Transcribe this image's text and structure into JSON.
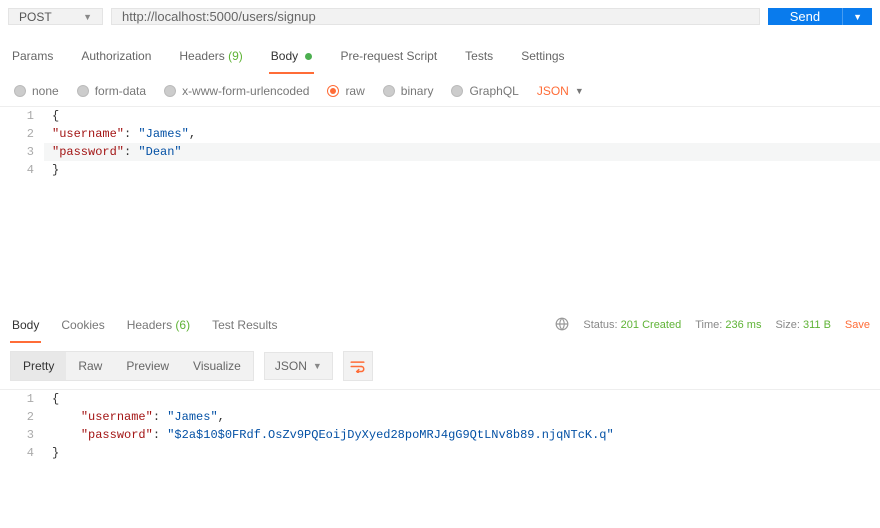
{
  "request": {
    "method": "POST",
    "url": "http://localhost:5000/users/signup",
    "send_label": "Send"
  },
  "tabs": {
    "params": "Params",
    "authorization": "Authorization",
    "headers": "Headers",
    "headers_count": "(9)",
    "body": "Body",
    "prerequest": "Pre-request Script",
    "tests": "Tests",
    "settings": "Settings"
  },
  "body_types": {
    "none": "none",
    "form_data": "form-data",
    "urlencoded": "x-www-form-urlencoded",
    "raw": "raw",
    "binary": "binary",
    "graphql": "GraphQL",
    "format": "JSON"
  },
  "request_body_lines": [
    {
      "n": "1",
      "indent": "",
      "tokens": [
        {
          "t": "p",
          "v": "{"
        }
      ]
    },
    {
      "n": "2",
      "indent": "",
      "tokens": [
        {
          "t": "k",
          "v": "\"username\""
        },
        {
          "t": "p",
          "v": ": "
        },
        {
          "t": "s",
          "v": "\"James\""
        },
        {
          "t": "p",
          "v": ","
        }
      ]
    },
    {
      "n": "3",
      "indent": "",
      "tokens": [
        {
          "t": "k",
          "v": "\"password\""
        },
        {
          "t": "p",
          "v": ": "
        },
        {
          "t": "s",
          "v": "\"Dean\""
        }
      ],
      "hl": true
    },
    {
      "n": "4",
      "indent": "",
      "tokens": [
        {
          "t": "p",
          "v": "}"
        }
      ]
    }
  ],
  "response_tabs": {
    "body": "Body",
    "cookies": "Cookies",
    "headers": "Headers",
    "headers_count": "(6)",
    "test_results": "Test Results"
  },
  "response_meta": {
    "status_label": "Status:",
    "status_value": "201 Created",
    "time_label": "Time:",
    "time_value": "236 ms",
    "size_label": "Size:",
    "size_value": "311 B",
    "save": "Save"
  },
  "response_views": {
    "pretty": "Pretty",
    "raw": "Raw",
    "preview": "Preview",
    "visualize": "Visualize",
    "format": "JSON"
  },
  "response_body_lines": [
    {
      "n": "1",
      "indent": "",
      "tokens": [
        {
          "t": "p",
          "v": "{"
        }
      ]
    },
    {
      "n": "2",
      "indent": "    ",
      "tokens": [
        {
          "t": "k",
          "v": "\"username\""
        },
        {
          "t": "p",
          "v": ": "
        },
        {
          "t": "s",
          "v": "\"James\""
        },
        {
          "t": "p",
          "v": ","
        }
      ]
    },
    {
      "n": "3",
      "indent": "    ",
      "tokens": [
        {
          "t": "k",
          "v": "\"password\""
        },
        {
          "t": "p",
          "v": ": "
        },
        {
          "t": "s",
          "v": "\"$2a$10$0FRdf.OsZv9PQEoijDyXyed28poMRJ4gG9QtLNv8b89.njqNTcK.q\""
        }
      ]
    },
    {
      "n": "4",
      "indent": "",
      "tokens": [
        {
          "t": "p",
          "v": "}"
        }
      ]
    }
  ]
}
